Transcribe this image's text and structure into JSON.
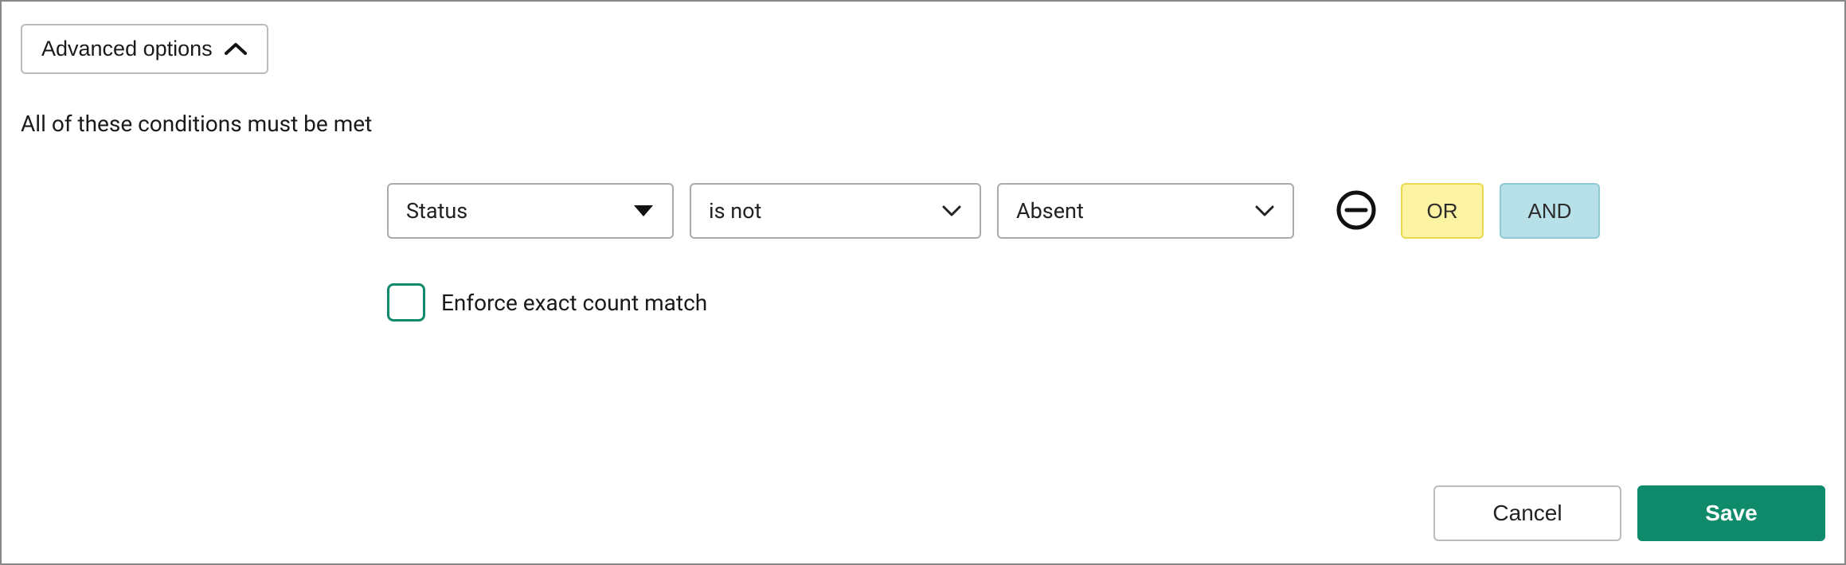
{
  "advanced_options": {
    "label": "Advanced options"
  },
  "conditions": {
    "heading": "All of these conditions must be met",
    "row": {
      "field": "Status",
      "operator": "is not",
      "value": "Absent",
      "or_label": "OR",
      "and_label": "AND"
    }
  },
  "enforce": {
    "label": "Enforce exact count match",
    "checked": false
  },
  "footer": {
    "cancel": "Cancel",
    "save": "Save"
  }
}
